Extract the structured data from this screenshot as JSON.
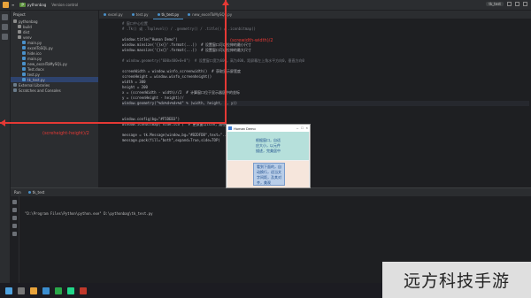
{
  "titlebar": {
    "menu": [
      "≡"
    ],
    "project": "pythonbag",
    "vcs": "Version control",
    "right_chip": "tk_test",
    "tab_active": "tk_test"
  },
  "project_panel": {
    "header": "Project",
    "items": [
      {
        "label": "pythonbag",
        "indent": 0,
        "type": "f"
      },
      {
        "label": "build",
        "indent": 1,
        "type": "f"
      },
      {
        "label": "dist",
        "indent": 1,
        "type": "f"
      },
      {
        "label": "venv",
        "indent": 1,
        "type": "f"
      },
      {
        "label": "main.py",
        "indent": 2,
        "type": "p"
      },
      {
        "label": "excelToSQL.py",
        "indent": 2,
        "type": "p"
      },
      {
        "label": "hide.ico",
        "indent": 2,
        "type": "p"
      },
      {
        "label": "main.py",
        "indent": 2,
        "type": "p"
      },
      {
        "label": "new_excelToMySQL.py",
        "indent": 2,
        "type": "p"
      },
      {
        "label": "Test.docx",
        "indent": 2,
        "type": "p"
      },
      {
        "label": "test.py",
        "indent": 2,
        "type": "p"
      },
      {
        "label": "tk_test.py",
        "indent": 2,
        "type": "p",
        "selected": true
      },
      {
        "label": "External Libraries",
        "indent": 0,
        "type": "l"
      },
      {
        "label": "Scratches and Consoles",
        "indent": 0,
        "type": "l"
      }
    ]
  },
  "tabs": [
    "excel.py",
    "test.py",
    "tk_test.py",
    "new_excelToMySQL.py"
  ],
  "code": [
    {
      "t": "# 窗口中心位置",
      "c": "cm"
    },
    {
      "t": "# .Tk() 或 .Toplevel() / .geometry() / .title() / .iconbitmap()",
      "c": "cm"
    },
    {
      "t": "",
      "c": ""
    },
    {
      "t": "window.title(\"Human Demo\")",
      "c": ""
    },
    {
      "t": "window.minsize('{}x{}'.format(...))  # 设置窗口可以拉伸的最小尺寸",
      "c": ""
    },
    {
      "t": "window.maxsize('{}x{}'.format(...))  # 设置窗口可以拉伸的最大尺寸",
      "c": ""
    },
    {
      "t": "",
      "c": ""
    },
    {
      "t": "# window.geometry(\"600x400+0+0\")  # 设置窗口宽为600，高为400，距屏幕左上角水平方向0，垂直方向0",
      "c": "cm"
    },
    {
      "t": "",
      "c": ""
    },
    {
      "t": "screenWidth = window.winfo_screenwidth()  # 获取显示屏宽度",
      "c": ""
    },
    {
      "t": "screenHeight = window.winfo_screenheight()",
      "c": ""
    },
    {
      "t": "width = 300",
      "c": ""
    },
    {
      "t": "height = 200",
      "c": ""
    },
    {
      "t": "x = (screenWidth - width)//2  # 计算窗口位于显示器居中的坐标",
      "c": ""
    },
    {
      "t": "y = (screenHeight - height)//",
      "c": ""
    },
    {
      "t": "window.geometry(\"%dx%d+%d+%d\" % (width, height, x, y))",
      "c": "hl"
    },
    {
      "t": "",
      "c": ""
    },
    {
      "t": "",
      "c": ""
    },
    {
      "t": "window.config(bg=\"#F5DEB3\")",
      "c": ""
    },
    {
      "t": "window.iconbitmap(\"hide.ico\")  # 更换窗口icon，路径",
      "c": ""
    },
    {
      "t": "",
      "c": ""
    },
    {
      "t": "message = tk.Message(window,bg=\"#B2DFDB\",text=\"...\",font=(\"Times\",\"12\",\"italic\"))",
      "c": ""
    },
    {
      "t": "message.pack(fill=\"both\",expand=True,side=TOP)",
      "c": ""
    }
  ],
  "run": {
    "label": "Run",
    "tab": "tk_test",
    "output": "\"D:\\Program Files\\Python\\python.exe\" D:\\pythonbag\\tk_test.py"
  },
  "demo": {
    "title": "Human Demo",
    "top_text": "根据窗口，自适应大小，以元件描述，完美居中",
    "bottom_text": "看到下面的，自动换行，适当文字间距，及其对齐，美观"
  },
  "annotations": {
    "width": "(screwidth-width)/2",
    "height": "(screheight-height)/2"
  },
  "watermark": "远方科技手游",
  "colors": {
    "annotation": "#e53935",
    "demo_top": "#b6e0db",
    "demo_bottom": "#f6e6dc"
  }
}
